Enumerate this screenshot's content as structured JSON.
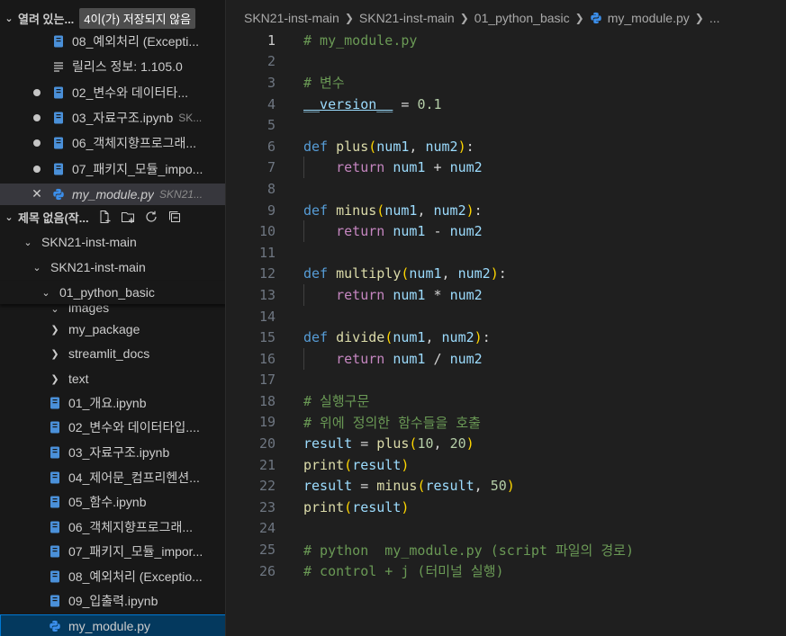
{
  "sidebar": {
    "open_editors": {
      "title": "열려 있는...",
      "unsaved_badge": "4이(가) 저장되지 않음",
      "items": [
        {
          "label": "08_예외처리 (Excepti...",
          "desc": "",
          "icon": "notebook-icon",
          "state": "none"
        },
        {
          "label": "릴리스 정보: 1.105.0",
          "desc": "",
          "icon": "release-notes-icon",
          "state": "none"
        },
        {
          "label": "02_변수와 데이터타...",
          "desc": "",
          "icon": "notebook-icon",
          "state": "dirty"
        },
        {
          "label": "03_자료구조.ipynb",
          "desc": "SK...",
          "icon": "notebook-icon",
          "state": "dirty"
        },
        {
          "label": "06_객체지향프로그래...",
          "desc": "",
          "icon": "notebook-icon",
          "state": "dirty"
        },
        {
          "label": "07_패키지_모듈_impo...",
          "desc": "",
          "icon": "notebook-icon",
          "state": "dirty"
        },
        {
          "label": "my_module.py",
          "desc": "SKN21...",
          "icon": "python-icon",
          "state": "active"
        }
      ]
    },
    "workspace": {
      "title": "제목 없음(작...",
      "actions": [
        "new-file-icon",
        "new-folder-icon",
        "refresh-icon",
        "collapse-all-icon"
      ],
      "tree": [
        {
          "label": "SKN21-inst-main",
          "kind": "folder-open",
          "level": 1
        },
        {
          "label": "SKN21-inst-main",
          "kind": "folder-open",
          "level": 2
        },
        {
          "label": "01_python_basic",
          "kind": "folder-open",
          "level": 3
        },
        {
          "label": "images",
          "kind": "folder-open",
          "level": 4
        },
        {
          "label": "my_package",
          "kind": "folder-closed",
          "level": 4
        },
        {
          "label": "streamlit_docs",
          "kind": "folder-closed",
          "level": 4
        },
        {
          "label": "text",
          "kind": "folder-closed",
          "level": 4
        },
        {
          "label": "01_개요.ipynb",
          "kind": "notebook",
          "level": 4
        },
        {
          "label": "02_변수와 데이터타입....",
          "kind": "notebook",
          "level": 4
        },
        {
          "label": "03_자료구조.ipynb",
          "kind": "notebook",
          "level": 4
        },
        {
          "label": "04_제어문_컴프리헨션...",
          "kind": "notebook",
          "level": 4
        },
        {
          "label": "05_함수.ipynb",
          "kind": "notebook",
          "level": 4
        },
        {
          "label": "06_객체지향프로그래...",
          "kind": "notebook",
          "level": 4
        },
        {
          "label": "07_패키지_모듈_impor...",
          "kind": "notebook",
          "level": 4
        },
        {
          "label": "08_예외처리 (Exceptio...",
          "kind": "notebook",
          "level": 4
        },
        {
          "label": "09_입출력.ipynb",
          "kind": "notebook",
          "level": 4
        },
        {
          "label": "my_module.py",
          "kind": "python",
          "level": 4,
          "selected": true
        }
      ]
    }
  },
  "breadcrumb": [
    "SKN21-inst-main",
    "SKN21-inst-main",
    "01_python_basic",
    "my_module.py",
    "..."
  ],
  "editor": {
    "current_line": 1,
    "lines": [
      [
        [
          "c-comment",
          "# my_module.py"
        ]
      ],
      [],
      [
        [
          "c-comment",
          "# 변수"
        ]
      ],
      [
        [
          "c-dunder",
          "__version__"
        ],
        [
          "c-op",
          " = "
        ],
        [
          "c-num",
          "0.1"
        ]
      ],
      [],
      [
        [
          "c-kw",
          "def"
        ],
        [
          "c-op",
          " "
        ],
        [
          "c-fn",
          "plus"
        ],
        [
          "c-p1",
          "("
        ],
        [
          "c-var",
          "num1"
        ],
        [
          "c-op",
          ", "
        ],
        [
          "c-var",
          "num2"
        ],
        [
          "c-p1",
          ")"
        ],
        [
          "c-op",
          ":"
        ]
      ],
      [
        [
          "c-op",
          "    "
        ],
        [
          "c-ctrl",
          "return"
        ],
        [
          "c-op",
          " "
        ],
        [
          "c-var",
          "num1"
        ],
        [
          "c-op",
          " + "
        ],
        [
          "c-var",
          "num2"
        ]
      ],
      [],
      [
        [
          "c-kw",
          "def"
        ],
        [
          "c-op",
          " "
        ],
        [
          "c-fn",
          "minus"
        ],
        [
          "c-p1",
          "("
        ],
        [
          "c-var",
          "num1"
        ],
        [
          "c-op",
          ", "
        ],
        [
          "c-var",
          "num2"
        ],
        [
          "c-p1",
          ")"
        ],
        [
          "c-op",
          ":"
        ]
      ],
      [
        [
          "c-op",
          "    "
        ],
        [
          "c-ctrl",
          "return"
        ],
        [
          "c-op",
          " "
        ],
        [
          "c-var",
          "num1"
        ],
        [
          "c-op",
          " - "
        ],
        [
          "c-var",
          "num2"
        ]
      ],
      [],
      [
        [
          "c-kw",
          "def"
        ],
        [
          "c-op",
          " "
        ],
        [
          "c-fn",
          "multiply"
        ],
        [
          "c-p1",
          "("
        ],
        [
          "c-var",
          "num1"
        ],
        [
          "c-op",
          ", "
        ],
        [
          "c-var",
          "num2"
        ],
        [
          "c-p1",
          ")"
        ],
        [
          "c-op",
          ":"
        ]
      ],
      [
        [
          "c-op",
          "    "
        ],
        [
          "c-ctrl",
          "return"
        ],
        [
          "c-op",
          " "
        ],
        [
          "c-var",
          "num1"
        ],
        [
          "c-op",
          " * "
        ],
        [
          "c-var",
          "num2"
        ]
      ],
      [],
      [
        [
          "c-kw",
          "def"
        ],
        [
          "c-op",
          " "
        ],
        [
          "c-fn",
          "divide"
        ],
        [
          "c-p1",
          "("
        ],
        [
          "c-var",
          "num1"
        ],
        [
          "c-op",
          ", "
        ],
        [
          "c-var",
          "num2"
        ],
        [
          "c-p1",
          ")"
        ],
        [
          "c-op",
          ":"
        ]
      ],
      [
        [
          "c-op",
          "    "
        ],
        [
          "c-ctrl",
          "return"
        ],
        [
          "c-op",
          " "
        ],
        [
          "c-var",
          "num1"
        ],
        [
          "c-op",
          " / "
        ],
        [
          "c-var",
          "num2"
        ]
      ],
      [],
      [
        [
          "c-comment",
          "# 실행구문"
        ]
      ],
      [
        [
          "c-comment",
          "# 위에 정의한 함수들을 호출"
        ]
      ],
      [
        [
          "c-var",
          "result"
        ],
        [
          "c-op",
          " = "
        ],
        [
          "c-fn",
          "plus"
        ],
        [
          "c-p1",
          "("
        ],
        [
          "c-num",
          "10"
        ],
        [
          "c-op",
          ", "
        ],
        [
          "c-num",
          "20"
        ],
        [
          "c-p1",
          ")"
        ]
      ],
      [
        [
          "c-fn",
          "print"
        ],
        [
          "c-p1",
          "("
        ],
        [
          "c-var",
          "result"
        ],
        [
          "c-p1",
          ")"
        ]
      ],
      [
        [
          "c-var",
          "result"
        ],
        [
          "c-op",
          " = "
        ],
        [
          "c-fn",
          "minus"
        ],
        [
          "c-p1",
          "("
        ],
        [
          "c-var",
          "result"
        ],
        [
          "c-op",
          ", "
        ],
        [
          "c-num",
          "50"
        ],
        [
          "c-p1",
          ")"
        ]
      ],
      [
        [
          "c-fn",
          "print"
        ],
        [
          "c-p1",
          "("
        ],
        [
          "c-var",
          "result"
        ],
        [
          "c-p1",
          ")"
        ]
      ],
      [],
      [
        [
          "c-comment",
          "# python  my_module.py (script 파일의 경로)"
        ]
      ],
      [
        [
          "c-comment",
          "# control + j (터미널 실행)"
        ]
      ]
    ]
  },
  "colors": {
    "sidebar_bg": "#181818",
    "editor_bg": "#1f1f1f",
    "selection_bg": "#04395e",
    "focus_border": "#0078d4",
    "python_icon": "#3b8eea",
    "notebook_icon": "#4a90d9"
  }
}
